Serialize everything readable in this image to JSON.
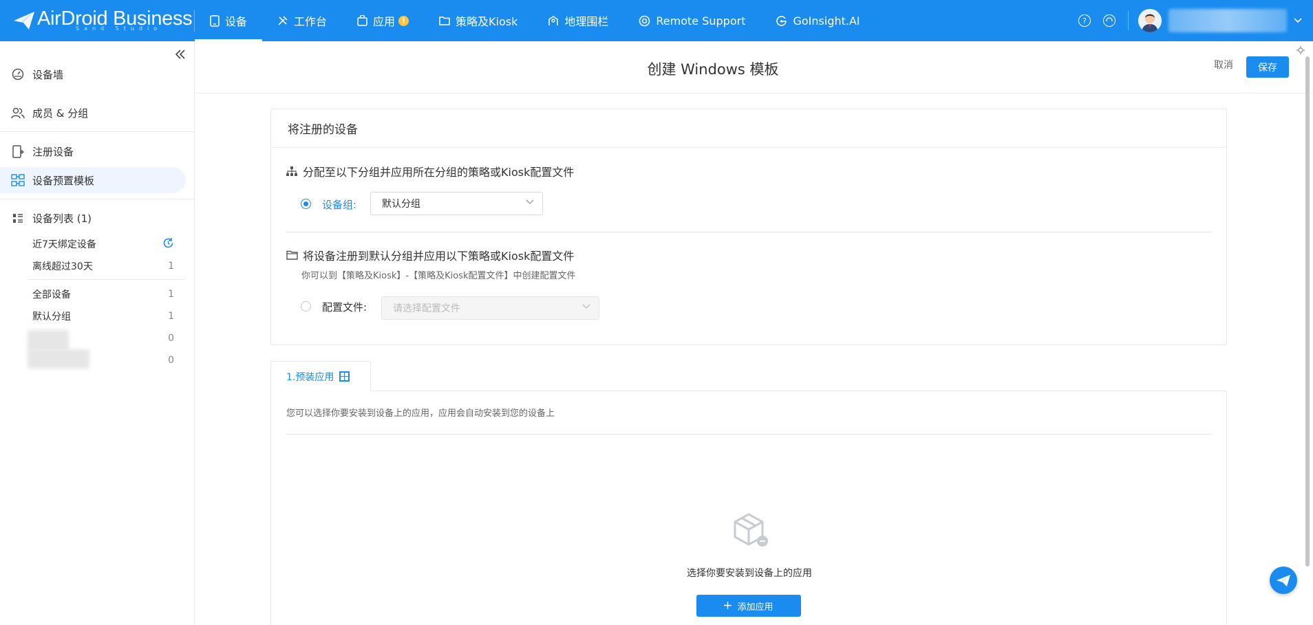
{
  "brand": {
    "name": "AirDroid Business",
    "subtitle": "Sand Studio"
  },
  "nav": {
    "items": [
      {
        "label": "设备",
        "icon": "tablet-icon"
      },
      {
        "label": "工作台",
        "icon": "tools-icon"
      },
      {
        "label": "应用",
        "icon": "app-bag-icon",
        "badge": "!"
      },
      {
        "label": "策略及Kiosk",
        "icon": "folder-icon"
      },
      {
        "label": "地理围栏",
        "icon": "map-pin-icon"
      },
      {
        "label": "Remote Support",
        "icon": "lifebuoy-icon"
      },
      {
        "label": "GoInsight.AI",
        "icon": "ai-icon"
      }
    ],
    "active": "设备"
  },
  "header_icons": {
    "help": "?",
    "support": "headset-icon"
  },
  "sidebar": {
    "main_items": [
      {
        "label": "设备墙",
        "icon": "dashboard-icon"
      },
      {
        "label": "成员 & 分组",
        "icon": "users-icon"
      },
      {
        "label": "注册设备",
        "icon": "register-device-icon"
      },
      {
        "label": "设备预置模板",
        "icon": "template-icon"
      },
      {
        "label": "设备列表 (1)",
        "icon": "list-icon"
      }
    ],
    "active": "设备预置模板",
    "recent": {
      "label": "近7天绑定设备"
    },
    "sub_items": [
      {
        "label": "离线超过30天",
        "count": "1"
      },
      {
        "label": "全部设备",
        "count": "1"
      },
      {
        "label": "默认分组",
        "count": "1"
      },
      {
        "label": "",
        "count": "0"
      },
      {
        "label": "",
        "count": "0"
      }
    ]
  },
  "page": {
    "title": "创建 Windows 模板",
    "cancel": "取消",
    "save": "保存"
  },
  "enroll_card": {
    "title": "将注册的设备",
    "option1": {
      "title": "分配至以下分组并应用所在分组的策略或Kiosk配置文件",
      "field_label": "设备组:",
      "select_value": "默认分组",
      "checked": true
    },
    "option2": {
      "title": "将设备注册到默认分组并应用以下策略或Kiosk配置文件",
      "hint": "你可以到【策略及Kiosk】-【策略及Kiosk配置文件】中创建配置文件",
      "field_label": "配置文件:",
      "select_placeholder": "请选择配置文件",
      "checked": false
    }
  },
  "apps_tab": {
    "tab_label": "1.预装应用",
    "hint": "您可以选择你要安装到设备上的应用，应用会自动安装到您的设备上",
    "empty_text": "选择你要安装到设备上的应用",
    "add_button": "添加应用"
  },
  "colors": {
    "primary": "#1a8cf0",
    "badge": "#ffc53d"
  }
}
